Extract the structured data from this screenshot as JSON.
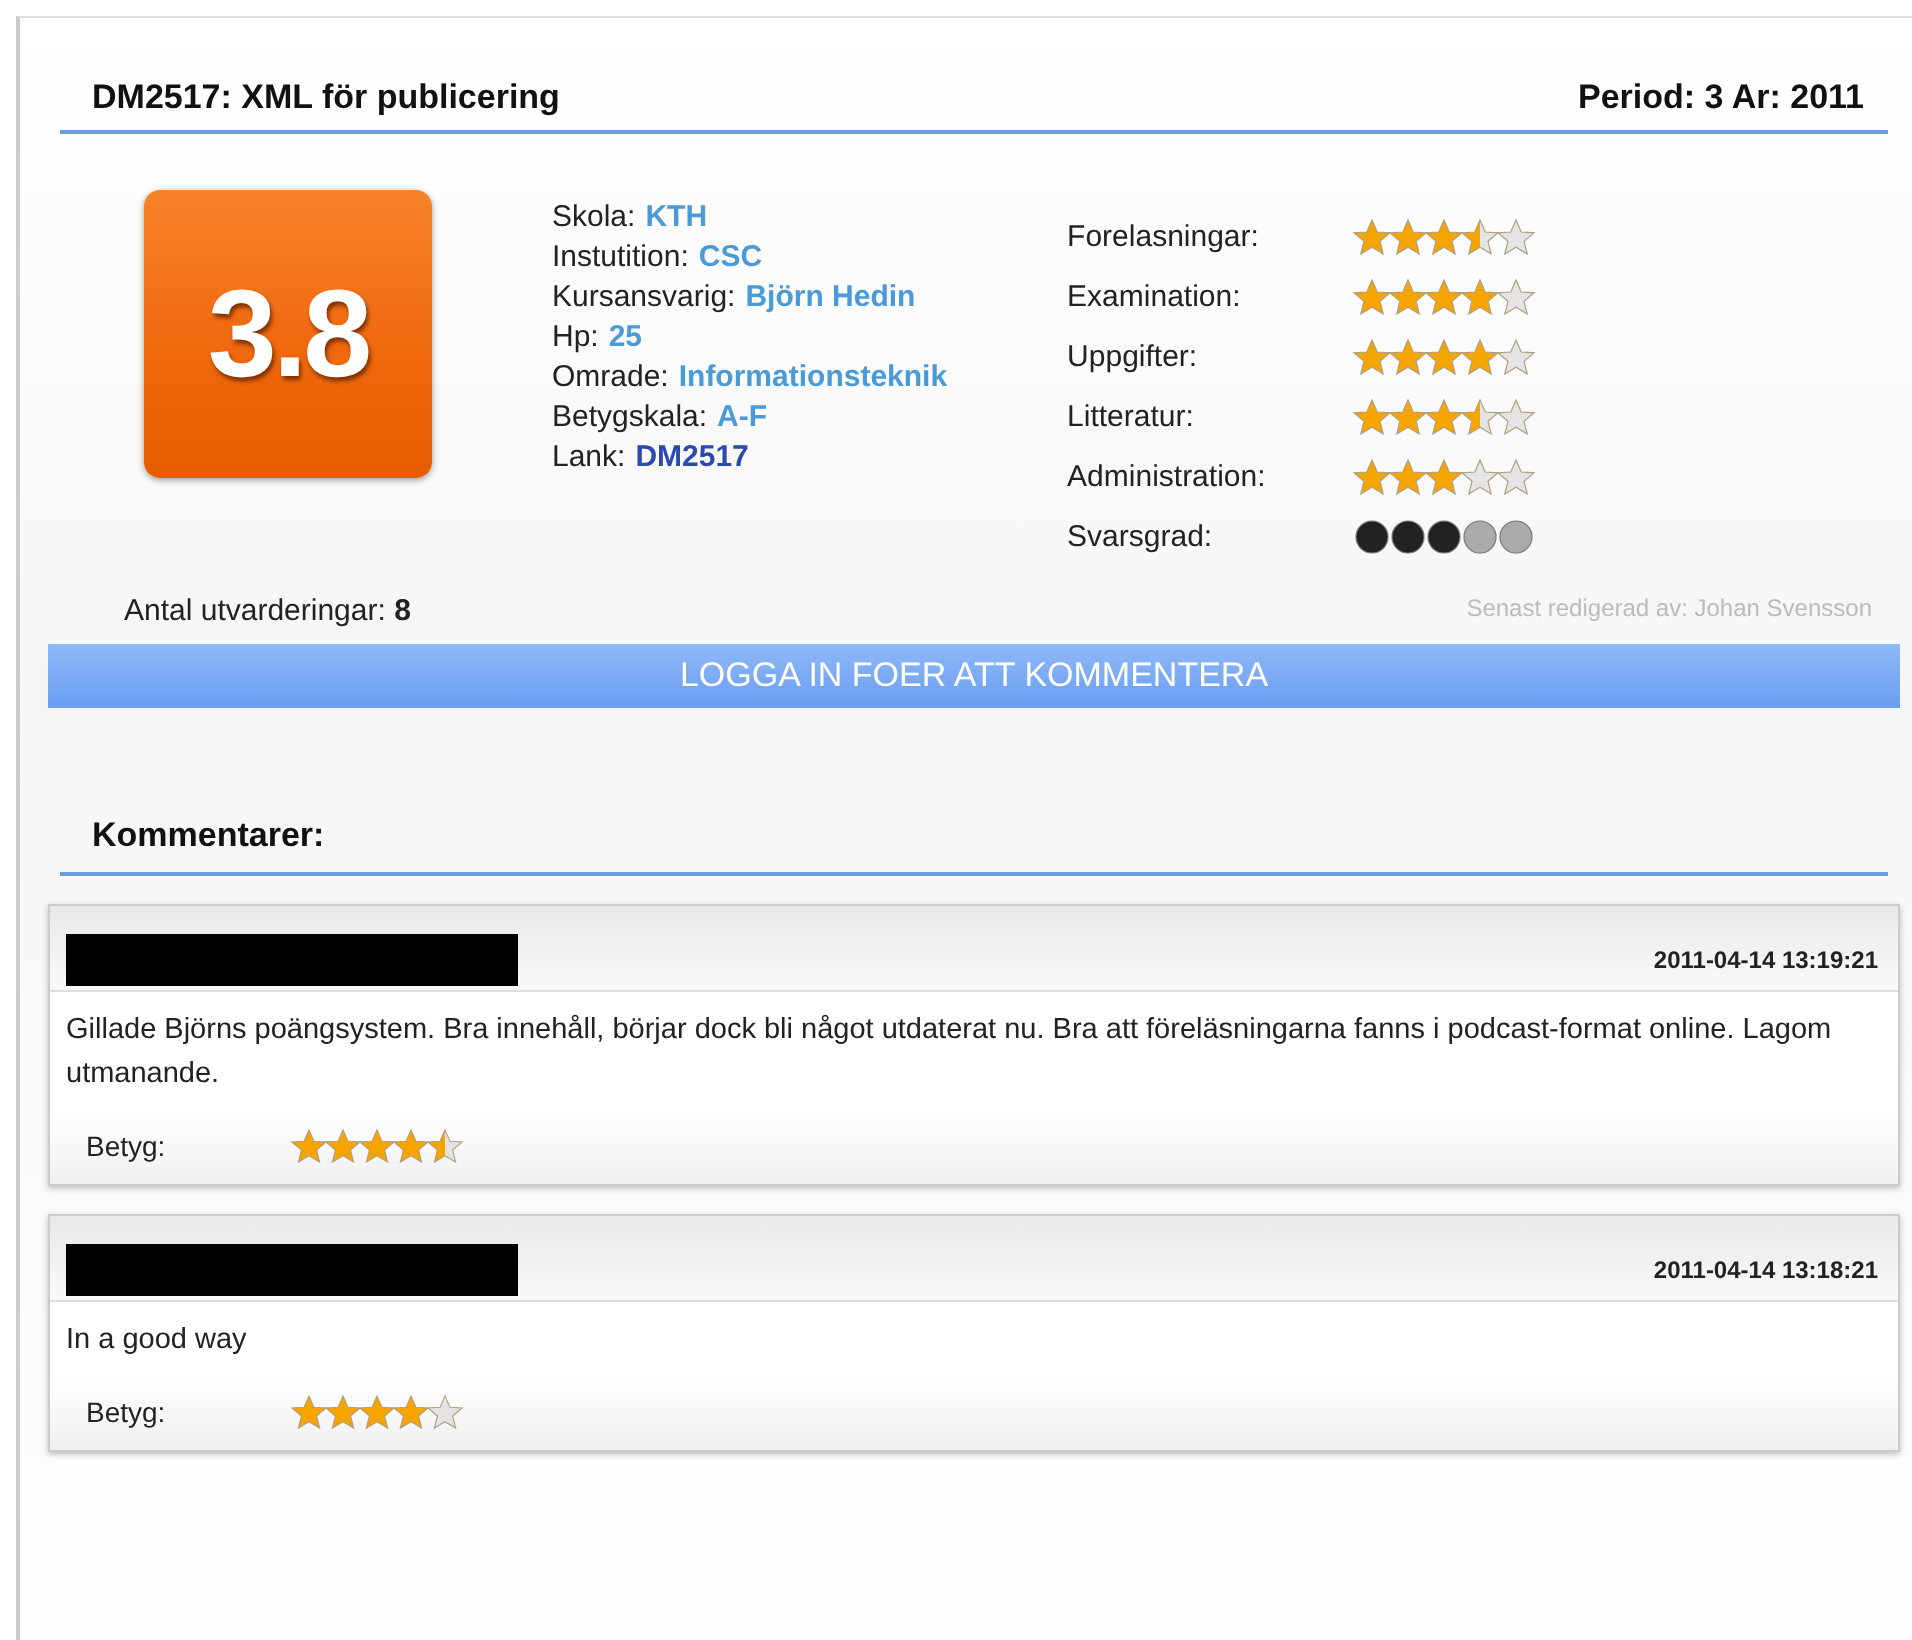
{
  "course": {
    "title": "DM2517: XML för publicering",
    "period": "Period: 3 Ar: 2011"
  },
  "score": "3.8",
  "info": [
    {
      "label": "Skola:",
      "value": "KTH",
      "kind": "text"
    },
    {
      "label": "Instutition:",
      "value": "CSC",
      "kind": "text"
    },
    {
      "label": "Kursansvarig:",
      "value": "Björn Hedin",
      "kind": "text"
    },
    {
      "label": "Hp:",
      "value": "25",
      "kind": "text"
    },
    {
      "label": "Omrade:",
      "value": "Informationsteknik",
      "kind": "text"
    },
    {
      "label": "Betygskala:",
      "value": "A-F",
      "kind": "text"
    },
    {
      "label": "Lank:",
      "value": "DM2517",
      "kind": "link"
    }
  ],
  "ratings": [
    {
      "label": "Forelasningar:",
      "stars": 3.5,
      "kind": "star"
    },
    {
      "label": "Examination:",
      "stars": 4,
      "kind": "star"
    },
    {
      "label": "Uppgifter:",
      "stars": 4,
      "kind": "star"
    },
    {
      "label": "Litteratur:",
      "stars": 3.5,
      "kind": "star"
    },
    {
      "label": "Administration:",
      "stars": 3,
      "kind": "star"
    },
    {
      "label": "Svarsgrad:",
      "stars": 3,
      "kind": "head"
    }
  ],
  "count": {
    "label": "Antal utvarderingar:",
    "value": "8"
  },
  "edited_by": "Senast redigerad av: Johan Svensson",
  "login_bar": "LOGGA IN FOER ATT KOMMENTERA",
  "comments_heading": "Kommentarer:",
  "comments": [
    {
      "date": "2011-04-14 13:19:21",
      "text": "Gillade Björns poängsystem. Bra innehåll, börjar dock bli något utdaterat nu. Bra att föreläsningarna fanns i podcast-format online. Lagom utmanande.",
      "grade_label": "Betyg:",
      "stars": 4.5
    },
    {
      "date": "2011-04-14 13:18:21",
      "text": "In a good way",
      "grade_label": "Betyg:",
      "stars": 4
    }
  ]
}
